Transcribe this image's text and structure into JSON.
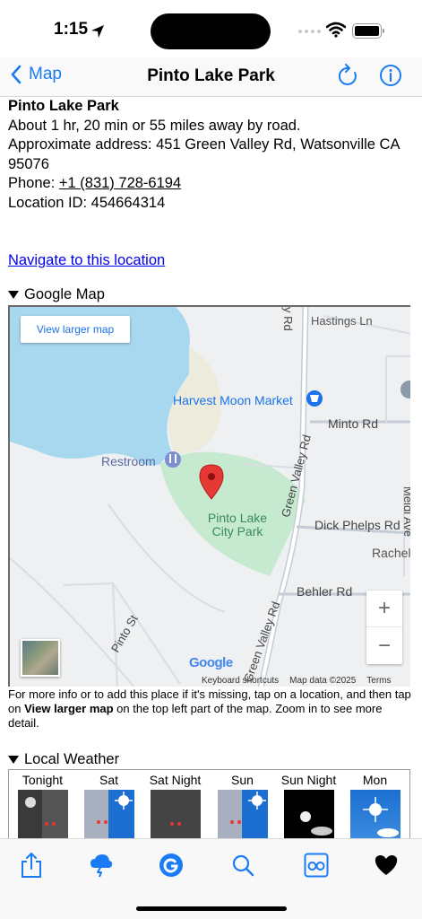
{
  "status": {
    "time": "1:15"
  },
  "nav": {
    "back_label": "Map",
    "title": "Pinto Lake Park"
  },
  "details": {
    "name": "Pinto Lake Park",
    "distance": "About 1 hr, 20 min or 55 miles away by road.",
    "address_label": "Approximate address:",
    "address": "451 Green Valley Rd, Watsonville CA 95076",
    "phone_label": "Phone:",
    "phone": "+1 (831) 728-6194",
    "location_id_label": "Location ID:",
    "location_id": "454664314",
    "navigate_link": "Navigate to this location"
  },
  "map_section": {
    "title": "Google Map",
    "view_larger": "View larger map",
    "labels": {
      "hastings": "Hastings Ln",
      "harvest": "Harvest Moon Market",
      "minto": "Minto Rd",
      "restroom": "Restroom",
      "park": "Pinto Lake City Park",
      "dick_phelps": "Dick Phelps Rd",
      "rachel": "Rachel",
      "behler": "Behler Rd",
      "green_valley": "Green Valley Rd",
      "pinto_st": "Pinto St",
      "meldi": "Meldi Ave",
      "y_rd": "y Rd"
    },
    "brand": "Google",
    "footer": {
      "shortcuts": "Keyboard shortcuts",
      "data": "Map data ©2025",
      "terms": "Terms"
    },
    "zoom_in": "+",
    "zoom_out": "−",
    "note_before": "For more info or to add this place if it's missing, tap on a location, and then tap on ",
    "note_bold": "View larger map",
    "note_after": " on the top left part of the map. Zoom in to see more detail."
  },
  "weather_section": {
    "title": "Local Weather",
    "days": [
      "Tonight",
      "Sat",
      "Sat Night",
      "Sun",
      "Sun Night",
      "Mon"
    ]
  },
  "colors": {
    "accent": "#1a7cf4",
    "link": "#0000ee",
    "water": "#a8d8f0",
    "park": "#c6ead0",
    "pin": "#e53935"
  },
  "icons": [
    "location-arrow-icon",
    "wifi-icon",
    "battery-icon",
    "chevron-left-icon",
    "refresh-icon",
    "info-icon",
    "share-icon",
    "weather-icon",
    "google-icon",
    "search-icon",
    "street-view-icon",
    "heart-icon"
  ]
}
